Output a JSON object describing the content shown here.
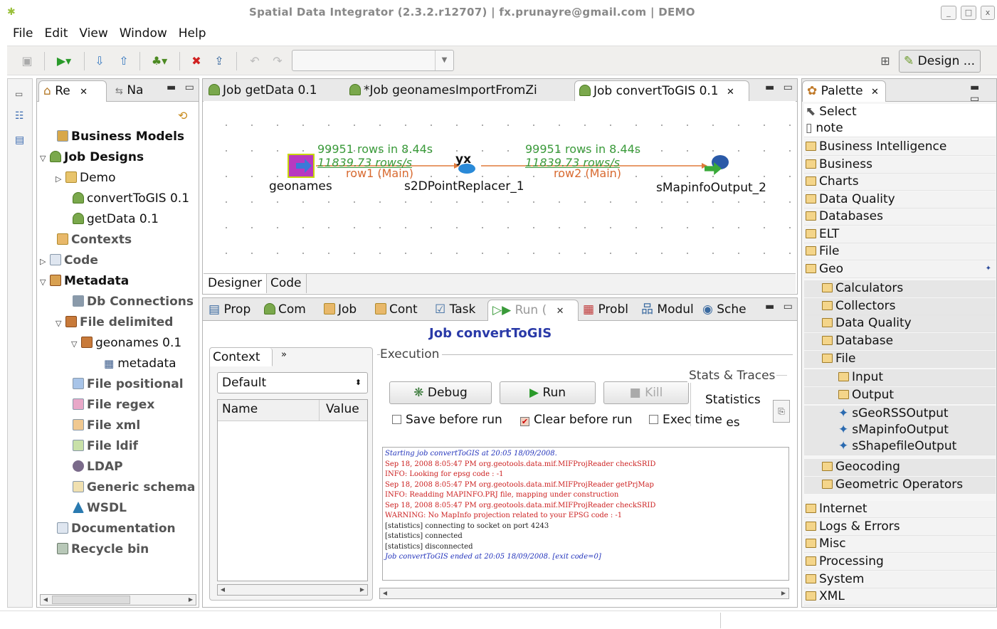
{
  "window": {
    "title": "Spatial Data Integrator (2.3.2.r12707) | fx.prunayre@gmail.com | DEMO"
  },
  "menu": [
    "File",
    "Edit",
    "View",
    "Window",
    "Help"
  ],
  "toolbar": {
    "design_label": "Design ..."
  },
  "repository": {
    "tabs": [
      "Re",
      "Na"
    ],
    "items": [
      "Business Models",
      "Job Designs",
      "Demo",
      "convertToGIS 0.1",
      "getData 0.1",
      "Contexts",
      "Code",
      "Metadata",
      "Db Connections",
      "File delimited",
      "geonames 0.1",
      "metadata",
      "File positional",
      "File regex",
      "File xml",
      "File ldif",
      "LDAP",
      "Generic schema",
      "WSDL",
      "Documentation",
      "Recycle bin"
    ]
  },
  "editor": {
    "tabs": [
      "Job getData 0.1",
      "*Job geonamesImportFromZi",
      "Job convertToGIS 0.1"
    ],
    "bottom_tabs": [
      "Designer",
      "Code"
    ],
    "components": [
      "geonames",
      "s2DPointReplacer_1",
      "sMapinfoOutput_2"
    ],
    "flows": [
      {
        "rows": "99951 rows in 8.44s",
        "rate": "11839.73 rows/s",
        "label": "row1 (Main)"
      },
      {
        "rows": "99951 rows in 8.44s",
        "rate": "11839.73 rows/s",
        "label": "row2 (Main)"
      }
    ]
  },
  "palette": {
    "title": "Palette",
    "items": [
      {
        "label": "Select",
        "kind": "tool"
      },
      {
        "label": "note",
        "kind": "tool"
      },
      {
        "label": "Business Intelligence",
        "kind": "folder"
      },
      {
        "label": "Business",
        "kind": "folder"
      },
      {
        "label": "Charts",
        "kind": "folder"
      },
      {
        "label": "Data Quality",
        "kind": "folder"
      },
      {
        "label": "Databases",
        "kind": "folder"
      },
      {
        "label": "ELT",
        "kind": "folder"
      },
      {
        "label": "File",
        "kind": "folder"
      },
      {
        "label": "Geo",
        "kind": "folder"
      },
      {
        "label": "Calculators",
        "kind": "folder"
      },
      {
        "label": "Collectors",
        "kind": "folder"
      },
      {
        "label": "Data Quality",
        "kind": "folder"
      },
      {
        "label": "Database",
        "kind": "folder"
      },
      {
        "label": "File",
        "kind": "folder"
      },
      {
        "label": "Input",
        "kind": "folder"
      },
      {
        "label": "Output",
        "kind": "folder"
      },
      {
        "label": "sGeoRSSOutput",
        "kind": "component"
      },
      {
        "label": "sMapinfoOutput",
        "kind": "component"
      },
      {
        "label": "sShapefileOutput",
        "kind": "component"
      },
      {
        "label": "Geocoding",
        "kind": "folder"
      },
      {
        "label": "Geometric Operators",
        "kind": "folder"
      },
      {
        "label": "Internet",
        "kind": "folder"
      },
      {
        "label": "Logs & Errors",
        "kind": "folder"
      },
      {
        "label": "Misc",
        "kind": "folder"
      },
      {
        "label": "Processing",
        "kind": "folder"
      },
      {
        "label": "System",
        "kind": "folder"
      },
      {
        "label": "XML",
        "kind": "folder"
      }
    ]
  },
  "bottom": {
    "tabs": [
      "Prop",
      "Com",
      "Job",
      "Cont",
      "Task",
      "Run (",
      "Probl",
      "Modul",
      "Sche"
    ],
    "job_title": "Job convertToGIS",
    "context_tab": "Context",
    "context_more": "»",
    "context_value": "Default",
    "table_headers": [
      "Name",
      "Value"
    ],
    "execution_label": "Execution",
    "debug_label": "Debug",
    "run_label": "Run",
    "kill_label": "Kill",
    "stats_group": "Stats & Traces",
    "statistics_label": "Statistics",
    "save_before_run": "Save before run",
    "clear_before_run": "Clear before run",
    "exec_time": "Exec time",
    "exec_time_suffix": "es",
    "console": [
      {
        "text": "Starting job convertToGIS at 20:05 18/09/2008.",
        "color": "blue"
      },
      {
        "text": "Sep 18, 2008 8:05:47 PM org.geotools.data.mif.MIFProjReader checkSRID",
        "color": "red"
      },
      {
        "text": "INFO: Looking for epsg code : -1",
        "color": "red"
      },
      {
        "text": "Sep 18, 2008 8:05:47 PM org.geotools.data.mif.MIFProjReader getPrjMap",
        "color": "red"
      },
      {
        "text": "INFO: Readding MAPINFO.PRJ file, mapping under construction",
        "color": "red"
      },
      {
        "text": "Sep 18, 2008 8:05:47 PM org.geotools.data.mif.MIFProjReader checkSRID",
        "color": "red"
      },
      {
        "text": "WARNING: No MapInfo projection related to your EPSG code : -1",
        "color": "red"
      },
      {
        "text": "[statistics] connecting to socket on port 4243",
        "color": "black"
      },
      {
        "text": "[statistics] connected",
        "color": "black"
      },
      {
        "text": "[statistics] disconnected",
        "color": "black"
      },
      {
        "text": "Job convertToGIS ended at 20:05 18/09/2008. [exit code=0]",
        "color": "blue"
      }
    ]
  }
}
